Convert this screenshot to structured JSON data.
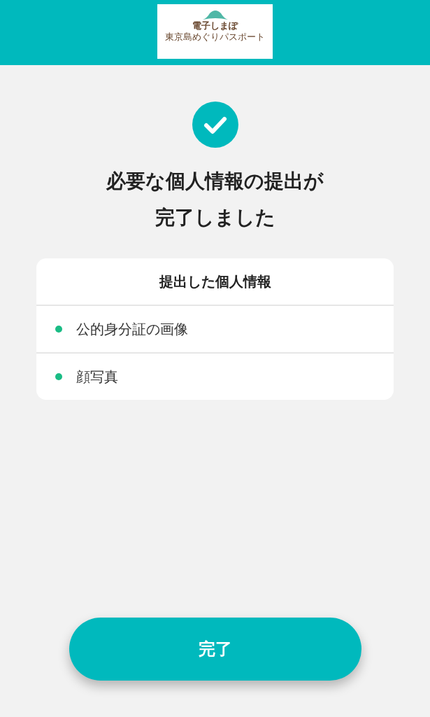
{
  "header": {
    "logo": {
      "name": "電子しまぽ",
      "tagline": "東京島めぐりパスポート"
    }
  },
  "title_lines": [
    "必要な個人情報の提出が",
    "完了しました"
  ],
  "card": {
    "title": "提出した個人情報",
    "items": [
      {
        "label": "公的身分証の画像",
        "color": "#1abc85"
      },
      {
        "label": "顔写真",
        "color": "#1abc85"
      }
    ]
  },
  "button": {
    "label": "完了"
  }
}
